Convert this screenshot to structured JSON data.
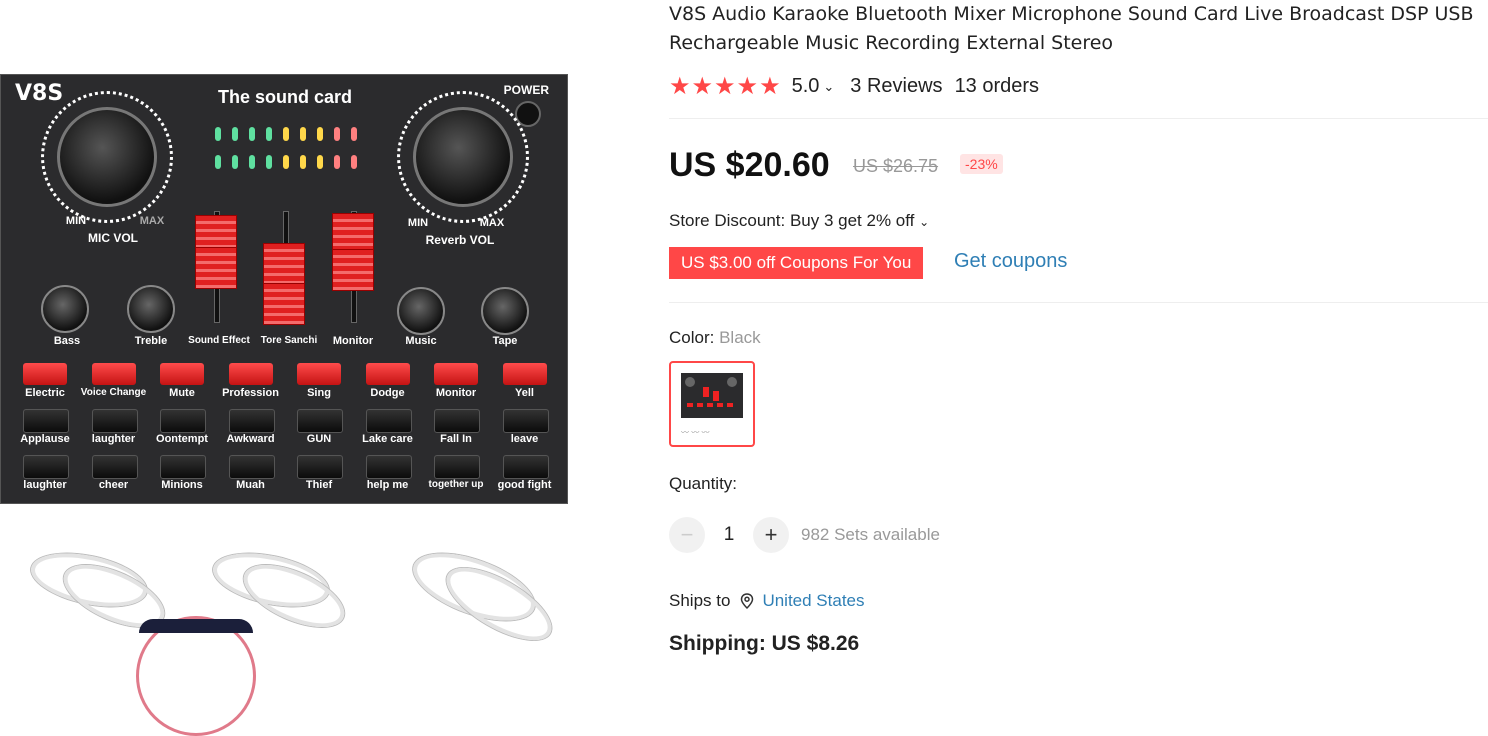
{
  "product": {
    "title": "V8S Audio Karaoke Bluetooth Mixer Microphone Sound Card Live Broadcast DSP USB Rechargeable Music Recording External Stereo",
    "rating": "5.0",
    "reviews": "3 Reviews",
    "orders": "13 orders",
    "price": "US $20.60",
    "old_price": "US $26.75",
    "discount": "-23%",
    "store_discount": "Store Discount: Buy 3 get 2% off",
    "coupon": "US $3.00 off Coupons For You",
    "get_coupons": "Get coupons",
    "color_label": "Color:",
    "color_value": "Black",
    "quantity_label": "Quantity:",
    "quantity_value": "1",
    "available": "982 Sets available",
    "ships_to_label": "Ships to",
    "ships_to_country": "United States",
    "shipping": "Shipping: US $8.26"
  },
  "device": {
    "brand": "V8S",
    "title": "The sound card",
    "power": "POWER",
    "mic_min": "MIN",
    "mic_max": "MAX",
    "mic_vol": "MIC VOL",
    "rev_min": "MIN",
    "rev_max": "MAX",
    "rev_vol": "Reverb VOL",
    "knobs": [
      "Bass",
      "Treble",
      "Sound Effect",
      "Tore Sanchi",
      "Monitor",
      "Music",
      "Tape"
    ],
    "red_row": [
      "Electric",
      "Voice Change",
      "Mute",
      "Profession",
      "Sing",
      "Dodge",
      "Monitor",
      "Yell"
    ],
    "row2": [
      "Applause",
      "laughter",
      "Oontempt",
      "Awkward",
      "GUN",
      "Lake care",
      "Fall In",
      "leave"
    ],
    "row3": [
      "laughter",
      "cheer",
      "Minions",
      "Muah",
      "Thief",
      "help me",
      "together up",
      "good fight"
    ]
  },
  "colors": {
    "accent": "#ff4747",
    "link": "#2f7fb5"
  },
  "icons": {
    "star": "star-icon",
    "chevron": "chevron-down-icon",
    "location": "location-pin-icon"
  }
}
